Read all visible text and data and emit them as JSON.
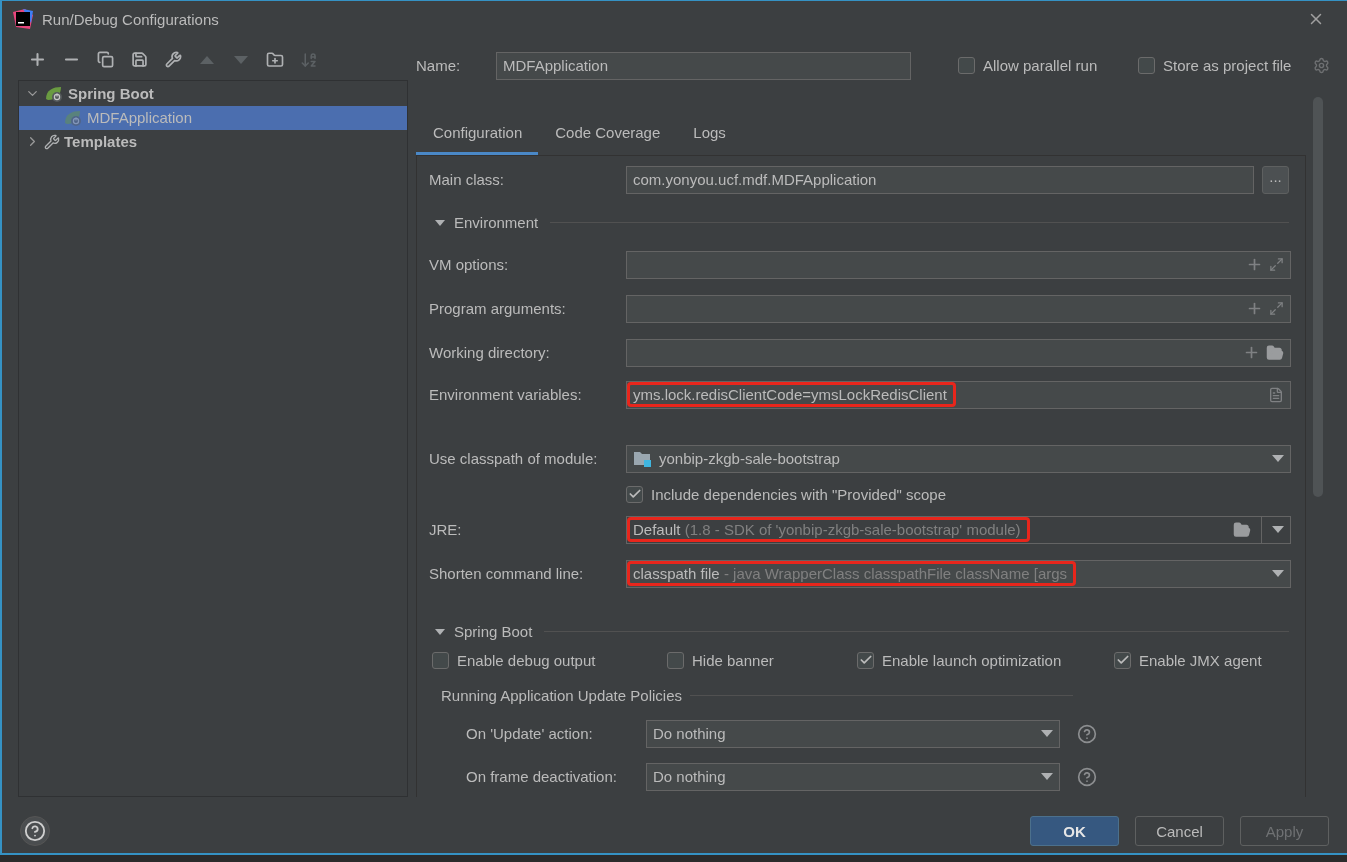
{
  "window": {
    "title": "Run/Debug Configurations"
  },
  "toolbar": [
    {
      "kind": "add",
      "disabled": false
    },
    {
      "kind": "remove",
      "disabled": false
    },
    {
      "kind": "copy",
      "disabled": false
    },
    {
      "kind": "save",
      "disabled": false
    },
    {
      "kind": "edit",
      "disabled": false
    },
    {
      "kind": "up",
      "disabled": true
    },
    {
      "kind": "down",
      "disabled": true
    },
    {
      "kind": "folder",
      "disabled": false
    },
    {
      "kind": "sort",
      "disabled": true
    }
  ],
  "tree": [
    {
      "label": "Spring Boot",
      "kind": "spring",
      "expanded": true,
      "selected": false,
      "children": [
        {
          "label": "MDFApplication",
          "kind": "app",
          "selected": true
        }
      ]
    },
    {
      "label": "Templates",
      "kind": "templates",
      "expanded": false,
      "selected": false
    }
  ],
  "name": {
    "label": "Name:",
    "value": "MDFApplication"
  },
  "header_options": [
    {
      "label": "Allow parallel run",
      "checked": false
    },
    {
      "label": "Store as project file",
      "checked": false
    }
  ],
  "tabs": [
    {
      "label": "Configuration",
      "selected": true
    },
    {
      "label": "Code Coverage",
      "selected": false
    },
    {
      "label": "Logs",
      "selected": false
    }
  ],
  "main_class": {
    "label": "Main class:",
    "value": "com.yonyou.ucf.mdf.MDFApplication",
    "button": "..."
  },
  "environment": {
    "title": "Environment",
    "expanded": true,
    "fields": [
      {
        "kind": "text",
        "label": "VM options:"
      },
      {
        "kind": "text",
        "label": "Program arguments:"
      },
      {
        "kind": "dir",
        "label": "Working directory:"
      },
      {
        "kind": "env",
        "label": "Environment variables:",
        "value": "yms.lock.redisClientCode=ymsLockRedisClient",
        "highlighted": true
      },
      {
        "kind": "module",
        "label": "Use classpath of module:",
        "value": "yonbip-zkgb-sale-bootstrap"
      },
      {
        "kind": "checkbox",
        "label": "Include dependencies with \"Provided\" scope",
        "checked": true
      },
      {
        "kind": "jre",
        "label": "JRE:",
        "value": "Default",
        "detail": "(1.8 - SDK of 'yonbip-zkgb-sale-bootstrap' module)",
        "highlighted": true
      },
      {
        "kind": "combo",
        "label": "Shorten command line:",
        "value": "classpath file",
        "detail": "- java WrapperClass classpathFile className [args",
        "highlighted": true
      }
    ]
  },
  "spring_boot": {
    "title": "Spring Boot",
    "expanded": true,
    "options": [
      {
        "label": "Enable debug output",
        "checked": false
      },
      {
        "label": "Hide banner",
        "checked": false
      },
      {
        "label": "Enable launch optimization",
        "checked": true
      },
      {
        "label": "Enable JMX agent",
        "checked": true
      }
    ],
    "policies": {
      "title": "Running Application Update Policies",
      "rows": [
        {
          "label": "On 'Update' action:",
          "value": "Do nothing"
        },
        {
          "label": "On frame deactivation:",
          "value": "Do nothing"
        }
      ]
    }
  },
  "buttons": [
    {
      "label": "OK",
      "default": true,
      "disabled": false
    },
    {
      "label": "Cancel",
      "default": false,
      "disabled": false
    },
    {
      "label": "Apply",
      "default": false,
      "disabled": true
    }
  ]
}
